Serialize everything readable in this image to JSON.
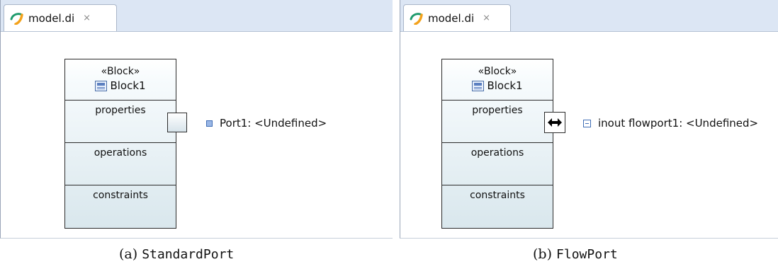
{
  "panels": [
    {
      "tab_label": "model.di",
      "block": {
        "stereotype": "«Block»",
        "name": "Block1",
        "compartments": [
          "properties",
          "operations",
          "constraints"
        ]
      },
      "port_label": "Port1: <Undefined>",
      "caption_prefix": "(a)",
      "caption_name": "StandardPort"
    },
    {
      "tab_label": "model.di",
      "block": {
        "stereotype": "«Block»",
        "name": "Block1",
        "compartments": [
          "properties",
          "operations",
          "constraints"
        ]
      },
      "port_label": "inout flowport1: <Undefined>",
      "caption_prefix": "(b)",
      "caption_name": "FlowPort"
    }
  ],
  "icons": {
    "tab_icon": "papyrus-logo-icon",
    "close_icon": "close-tab-icon",
    "block_icon": "block-class-icon",
    "standard_port_icon": "port-square-icon",
    "flow_port_icon": "flow-port-icon"
  },
  "colors": {
    "tabbar": "#dce6f4",
    "block_gradient_end": "#d9e7ed",
    "port_icon": "#3f6db5"
  }
}
